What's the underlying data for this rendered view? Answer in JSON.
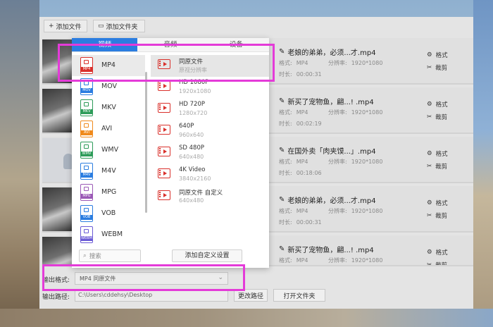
{
  "toolbar": {
    "add_file": "添加文件",
    "add_folder": "添加文件夹"
  },
  "videos": [
    {
      "title": "老娘的弟弟，必须...才.mp4",
      "format_label": "格式:",
      "format": "MP4",
      "res_label": "分辨率:",
      "resolution": "1920*1080",
      "dur_label": "时长:",
      "duration": "00:00:31"
    },
    {
      "title": "新买了宠物鱼，翩...! .mp4",
      "format_label": "格式:",
      "format": "MP4",
      "res_label": "分辨率:",
      "resolution": "1920*1080",
      "dur_label": "时长:",
      "duration": "00:02:19"
    },
    {
      "title": "在国外卖「肉夹馍...」.mp4",
      "format_label": "格式:",
      "format": "MP4",
      "res_label": "分辨率:",
      "resolution": "1920*1080",
      "dur_label": "时长:",
      "duration": "00:18:06"
    },
    {
      "title": "老娘的弟弟，必须...才.mp4",
      "format_label": "格式:",
      "format": "MP4",
      "res_label": "分辨率:",
      "resolution": "1920*1080",
      "dur_label": "时长:",
      "duration": "00:00:31"
    },
    {
      "title": "新买了宠物鱼，翩...! .mp4",
      "format_label": "格式:",
      "format": "MP4",
      "res_label": "分辨率:",
      "resolution": "1920*1080",
      "dur_label": "",
      "duration": ""
    }
  ],
  "row_actions": {
    "format": "格式",
    "trim": "裁剪"
  },
  "bottom": {
    "output_format_label": "输出格式:",
    "output_format_value": "MP4  同原文件",
    "output_path_label": "输出路径:",
    "output_path_value": "C:\\Users\\cddehsy\\Desktop",
    "change_path": "更改路径",
    "open_folder": "打开文件夹"
  },
  "popup": {
    "tabs": [
      "视频",
      "音频",
      "设备"
    ],
    "formats": [
      "MP4",
      "MOV",
      "MKV",
      "AVI",
      "WMV",
      "M4V",
      "MPG",
      "VOB",
      "WEBM"
    ],
    "format_badges": [
      "MP4",
      "MOV",
      "MKV",
      "AVI",
      "WMV",
      "M4V",
      "MPG",
      "VOB",
      "WEBM"
    ],
    "search_placeholder": "搜索",
    "resolutions": [
      {
        "name": "同原文件",
        "sub": "原视分辨率"
      },
      {
        "name": "HD 1080P",
        "sub": "1920x1080"
      },
      {
        "name": "HD 720P",
        "sub": "1280x720"
      },
      {
        "name": "640P",
        "sub": "960x640"
      },
      {
        "name": "SD 480P",
        "sub": "640x480"
      },
      {
        "name": "4K Video",
        "sub": "3840x2160"
      },
      {
        "name": "同原文件 自定义",
        "sub": "640x480"
      }
    ],
    "add_custom": "添加自定义设置"
  },
  "colors": {
    "accent": "#2b7de0",
    "highlight": "#e43bd8",
    "icon_red": "#d9302b",
    "format_badge_colors": [
      "#d9302b",
      "#2b7de0",
      "#2e9c5a",
      "#f08a1c",
      "#2e9c5a",
      "#2b7de0",
      "#9b59b6",
      "#2b7de0",
      "#6b5bd6"
    ]
  }
}
